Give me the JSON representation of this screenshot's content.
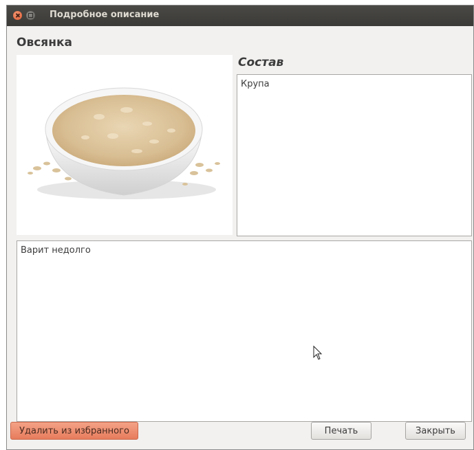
{
  "window": {
    "title": "Подробное описание"
  },
  "dish": {
    "name": "Овсянка",
    "photo_icon": "oatmeal-bowl-photo"
  },
  "ingredients": {
    "heading": "Состав",
    "text": "Крупа"
  },
  "description": {
    "text": "Варит недолго"
  },
  "buttons": {
    "remove": "Удалить из избранного",
    "print": "Печать",
    "close": "Закрыть"
  },
  "colors": {
    "titlebar": "#3b3a37",
    "close_button": "#e0582f",
    "remove_button": "#e77c5c",
    "window_bg": "#f2f1f0"
  }
}
